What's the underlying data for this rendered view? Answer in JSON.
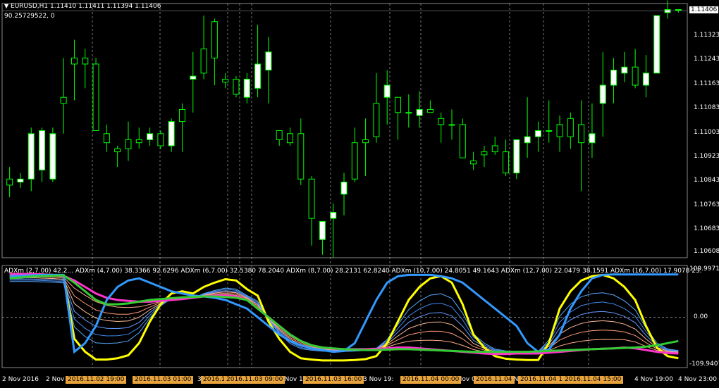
{
  "window": {
    "symbol_line": "EURUSD,H1  1.11410 1.11411 1.11394 1.11406",
    "sub_line": "90.25729522, 0"
  },
  "price_axis": {
    "labels": [
      "1.11406",
      "1.11323",
      "1.11243",
      "1.11163",
      "1.11083",
      "1.11003",
      "1.10923",
      "1.10843",
      "1.10763",
      "1.10683",
      "1.10608"
    ],
    "current_price": "1.11406"
  },
  "indicator": {
    "legend": "ADXm (2,7.00) 42.2... ADXm (4,7.00) 38.3366 92.6296  ADXm (6,7.00) 32.5380 78.2040  ADXm (8,7.00) 28.2131 62.8240  ADXm (10,7.00) 24.8051 49.1643  ADXm (12,7.00) 22.0479 38.1591  ADXm (16,7.00) 17.9078 23.",
    "axis_labels": [
      "109.9971",
      "0.00",
      "-109.9407"
    ]
  },
  "time_axis": {
    "labels": [
      "2 Nov 2016",
      "2 Nov",
      "3 Nov",
      "3 Nov 11:",
      "3 Nov 19:",
      "4 Nov 03:",
      "4 Nov 11:",
      "4 Nov 19:00",
      "4 Nov 23:00"
    ],
    "badges": [
      "2016.11.02 19:00",
      "2016.11.03 01:00",
      "2016.1",
      "2016.11.03 09:00",
      "2016.11.03 16:00",
      "2016.11.04 00:00",
      "2016.11.04",
      "2016.11.04 11",
      "2016.11.04 15:00"
    ]
  },
  "colors": {
    "background": "#000000",
    "bull_candle": "#ffffff",
    "bear_candle": "#000000",
    "candle_outline": "#00ff00",
    "grid": "#4a4a4a",
    "badge": "#e8a33c",
    "line_yellow": "#ffff00",
    "line_magenta": "#ff33cc",
    "line_blue": "#3399ff",
    "line_green": "#33cc33",
    "line_salmon": "#ffaa88"
  },
  "chart_data": {
    "type": "candlestick",
    "ylim": [
      1.1059,
      1.1143
    ],
    "candles": [
      [
        1.1085,
        1.1089,
        1.1079,
        1.1083
      ],
      [
        1.1084,
        1.1087,
        1.1082,
        1.1085
      ],
      [
        1.1085,
        1.1102,
        1.1081,
        1.11
      ],
      [
        1.1088,
        1.1102,
        1.1084,
        1.1101
      ],
      [
        1.1085,
        1.1102,
        1.1084,
        1.11
      ],
      [
        1.1112,
        1.1125,
        1.11,
        1.111
      ],
      [
        1.1125,
        1.1131,
        1.1111,
        1.1123
      ],
      [
        1.1125,
        1.1128,
        1.1115,
        1.1123
      ],
      [
        1.1123,
        1.1125,
        1.1101,
        1.1101
      ],
      [
        1.11,
        1.1103,
        1.1094,
        1.1097
      ],
      [
        1.1095,
        1.1096,
        1.1089,
        1.1094
      ],
      [
        1.1098,
        1.1104,
        1.1091,
        1.1095
      ],
      [
        1.1098,
        1.1102,
        1.1095,
        1.1097
      ],
      [
        1.1098,
        1.1102,
        1.1096,
        1.11
      ],
      [
        1.11,
        1.1101,
        1.1095,
        1.1096
      ],
      [
        1.1096,
        1.1105,
        1.1094,
        1.1104
      ],
      [
        1.1108,
        1.111,
        1.1094,
        1.1104
      ],
      [
        1.1118,
        1.1127,
        1.1107,
        1.1119
      ],
      [
        1.1128,
        1.1139,
        1.1118,
        1.112
      ],
      [
        1.1137,
        1.1138,
        1.1116,
        1.1125
      ],
      [
        1.1118,
        1.112,
        1.1115,
        1.1117
      ],
      [
        1.1118,
        1.1119,
        1.1112,
        1.1113
      ],
      [
        1.1112,
        1.112,
        1.111,
        1.1118
      ],
      [
        1.1115,
        1.1136,
        1.1112,
        1.1123
      ],
      [
        1.1121,
        1.1132,
        1.111,
        1.1127
      ],
      [
        1.1101,
        1.1101,
        1.1096,
        1.1098
      ],
      [
        1.11,
        1.1102,
        1.1096,
        1.1097
      ],
      [
        1.11,
        1.1105,
        1.1083,
        1.1085
      ],
      [
        1.1085,
        1.1086,
        1.1063,
        1.1072
      ],
      [
        1.1065,
        1.107,
        1.106,
        1.1071
      ],
      [
        1.1072,
        1.1077,
        1.1059,
        1.1074
      ],
      [
        1.108,
        1.1087,
        1.1073,
        1.1084
      ],
      [
        1.1097,
        1.1102,
        1.1084,
        1.1085
      ],
      [
        1.1098,
        1.1105,
        1.1086,
        1.1097
      ],
      [
        1.111,
        1.112,
        1.1097,
        1.1099
      ],
      [
        1.1112,
        1.1121,
        1.1103,
        1.1116
      ],
      [
        1.1112,
        1.1111,
        1.1098,
        1.1107
      ],
      [
        1.1107,
        1.1113,
        1.1102,
        1.1107
      ],
      [
        1.1106,
        1.1114,
        1.1102,
        1.1108
      ],
      [
        1.1108,
        1.1111,
        1.1107,
        1.1107
      ],
      [
        1.1105,
        1.1107,
        1.1097,
        1.1103
      ],
      [
        1.1103,
        1.1108,
        1.1098,
        1.1103
      ],
      [
        1.1103,
        1.1105,
        1.1092,
        1.1092
      ],
      [
        1.1091,
        1.1094,
        1.1088,
        1.109
      ],
      [
        1.1094,
        1.1096,
        1.1089,
        1.1093
      ],
      [
        1.1096,
        1.1099,
        1.1093,
        1.1094
      ],
      [
        1.1094,
        1.1098,
        1.1086,
        1.1087
      ],
      [
        1.1087,
        1.1098,
        1.1085,
        1.1098
      ],
      [
        1.1097,
        1.1112,
        1.1092,
        1.1099
      ],
      [
        1.1099,
        1.1104,
        1.1094,
        1.1101
      ],
      [
        1.1101,
        1.1111,
        1.1097,
        1.1101
      ],
      [
        1.1103,
        1.1106,
        1.1094,
        1.1099
      ],
      [
        1.1105,
        1.1107,
        1.1095,
        1.1099
      ],
      [
        1.1103,
        1.1111,
        1.1081,
        1.1097
      ],
      [
        1.1097,
        1.111,
        1.1092,
        1.11
      ],
      [
        1.111,
        1.1127,
        1.1099,
        1.1116
      ],
      [
        1.1116,
        1.1125,
        1.111,
        1.1121
      ],
      [
        1.112,
        1.1127,
        1.1117,
        1.1122
      ],
      [
        1.1122,
        1.1128,
        1.1115,
        1.1116
      ],
      [
        1.1116,
        1.1126,
        1.1112,
        1.112
      ],
      [
        1.112,
        1.1138,
        1.112,
        1.1139
      ],
      [
        1.114,
        1.1144,
        1.1138,
        1.1141
      ],
      [
        1.1141,
        1.1141,
        1.114,
        1.1141
      ]
    ],
    "indicator_ylim": [
      -110,
      110
    ],
    "indicator_series": [
      {
        "color": "#ffff00",
        "values": [
          100,
          100,
          100,
          99,
          98,
          96,
          -50,
          -80,
          -98,
          -98,
          -95,
          -88,
          -60,
          -10,
          30,
          55,
          60,
          55,
          70,
          80,
          88,
          85,
          65,
          50,
          -10,
          -50,
          -80,
          -95,
          -98,
          -100,
          -100,
          -100,
          -99,
          -97,
          -90,
          -60,
          -10,
          40,
          70,
          90,
          95,
          80,
          30,
          -40,
          -70,
          -90,
          -96,
          -98,
          -99,
          -99,
          -60,
          20,
          60,
          85,
          95,
          98,
          90,
          70,
          40,
          -20,
          -70,
          -90,
          -95
        ]
      },
      {
        "color": "#ff33cc",
        "values": [
          100,
          100,
          100,
          99,
          98,
          96,
          85,
          70,
          55,
          45,
          40,
          38,
          36,
          36,
          38,
          40,
          42,
          45,
          48,
          50,
          50,
          48,
          40,
          20,
          0,
          -20,
          -40,
          -55,
          -65,
          -70,
          -73,
          -74,
          -74,
          -74,
          -73,
          -72,
          -70,
          -70,
          -72,
          -74,
          -76,
          -78,
          -80,
          -82,
          -84,
          -85,
          -85,
          -84,
          -84,
          -84,
          -82,
          -80,
          -78,
          -76,
          -74,
          -73,
          -72,
          -70,
          -72,
          -76,
          -80,
          -83,
          -84
        ]
      },
      {
        "color": "#3399ff",
        "values": [
          95,
          96,
          97,
          98,
          98,
          98,
          -80,
          -60,
          -20,
          40,
          70,
          85,
          90,
          80,
          70,
          60,
          55,
          50,
          48,
          45,
          40,
          30,
          20,
          0,
          -20,
          -40,
          -55,
          -65,
          -72,
          -76,
          -80,
          -78,
          -60,
          -10,
          40,
          80,
          95,
          98,
          98,
          98,
          95,
          90,
          80,
          60,
          40,
          20,
          0,
          -20,
          -60,
          -80,
          -75,
          -40,
          20,
          60,
          90,
          98,
          99,
          99,
          99,
          99,
          99,
          99,
          99
        ]
      },
      {
        "color": "#33cc33",
        "values": [
          90,
          92,
          94,
          95,
          96,
          97,
          80,
          60,
          40,
          30,
          30,
          32,
          36,
          40,
          42,
          44,
          46,
          47,
          48,
          48,
          47,
          45,
          40,
          20,
          0,
          -20,
          -40,
          -55,
          -65,
          -70,
          -72,
          -74,
          -75,
          -76,
          -76,
          -75,
          -74,
          -74,
          -75,
          -76,
          -77,
          -78,
          -79,
          -80,
          -80,
          -80,
          -80,
          -80,
          -80,
          -79,
          -78,
          -77,
          -76,
          -75,
          -74,
          -73,
          -72,
          -71,
          -70,
          -68,
          -65,
          -60,
          -55
        ]
      }
    ]
  }
}
